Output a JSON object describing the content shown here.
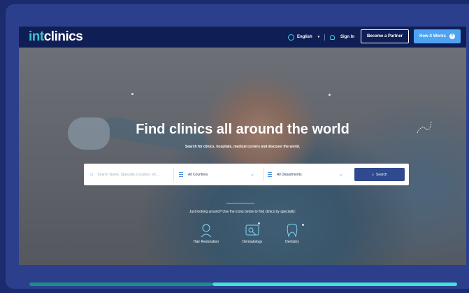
{
  "nav": {
    "logo_prefix": "int",
    "logo_suffix": "clinics",
    "language": "English",
    "sign_in": "Sign In",
    "partner_button": "Become a Partner",
    "how_button": "How it Works"
  },
  "hero": {
    "title": "Find clinics all around the world",
    "subtitle": "Search for clinics, hospitals, medical centers and discover the world."
  },
  "search": {
    "placeholder": "Search Name, Specialty, Location, etc...",
    "country": "All Countries",
    "department": "All Departments",
    "button": "Search"
  },
  "hint": "Just looking around? Use the icons below to find clinics by speciality:",
  "specialities": [
    {
      "label": "Hair Restoration",
      "icon": "hair-restoration-icon"
    },
    {
      "label": "Dermatology",
      "icon": "dermatology-icon"
    },
    {
      "label": "Dentistry",
      "icon": "dentistry-icon"
    }
  ],
  "colors": {
    "background": "#1c2b6e",
    "nav": "#0f1f55",
    "accent": "#3fc1c9",
    "how_button": "#4ea4f2",
    "search_button": "#2f4a8e"
  }
}
